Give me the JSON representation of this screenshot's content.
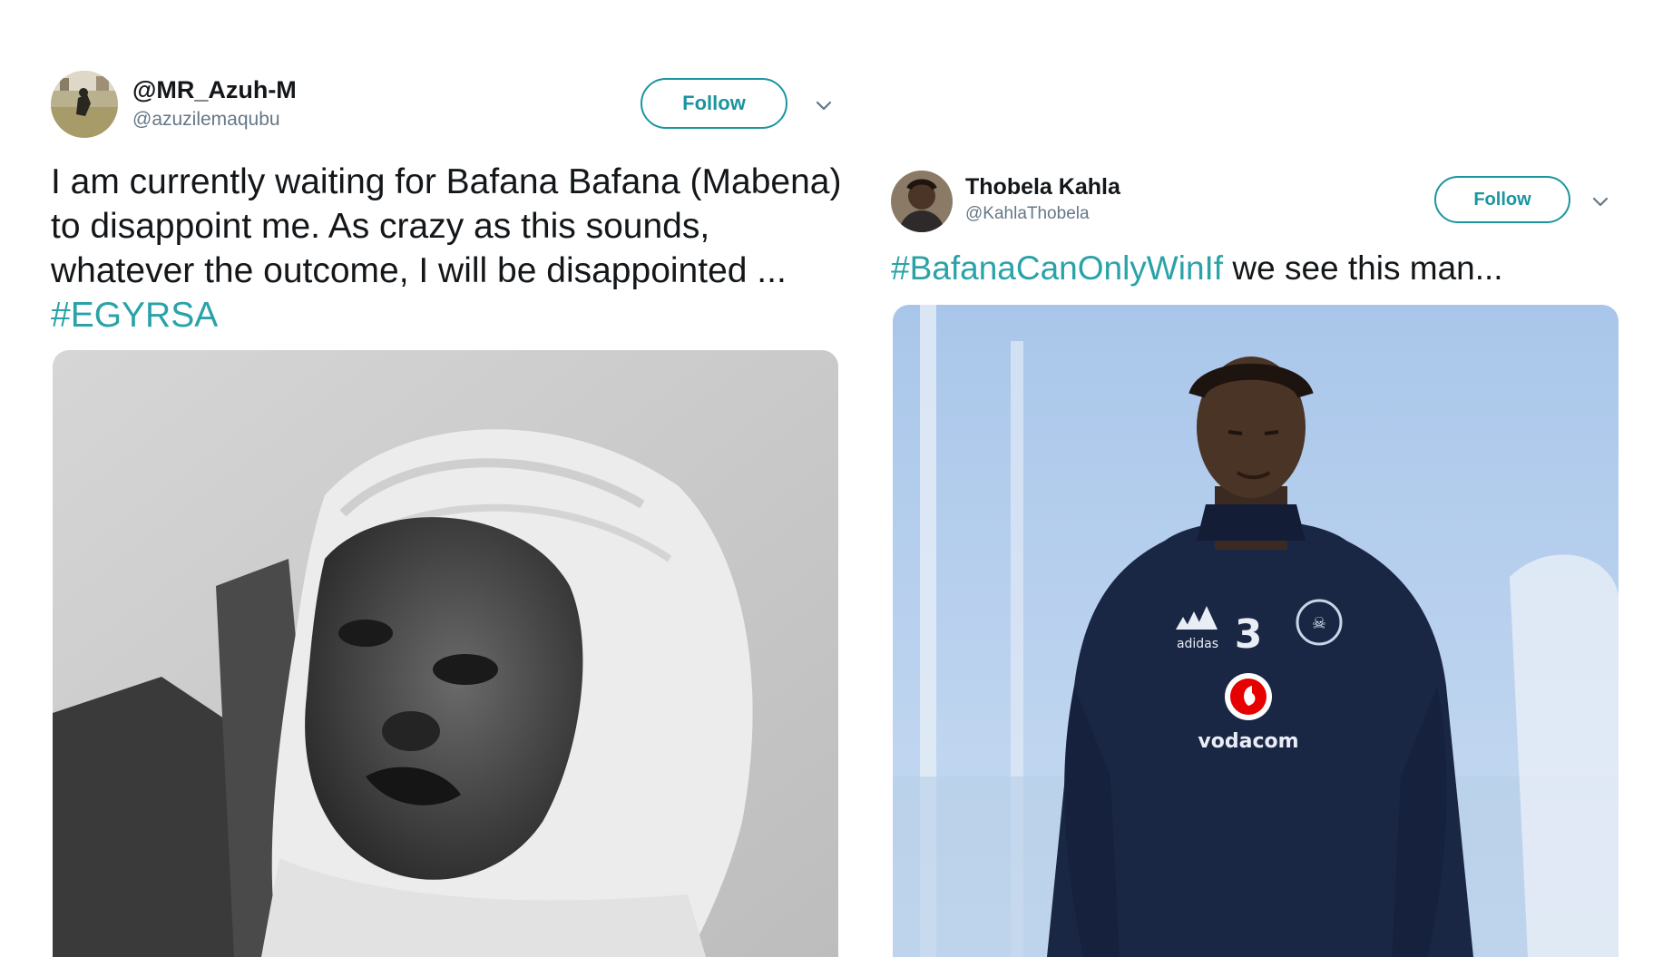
{
  "tweets": [
    {
      "display_name": "@MR_Azuh-M",
      "handle": "@azuzilemaqubu",
      "follow_label": "Follow",
      "text_plain": "I am currently waiting for Bafana Bafana (Mabena) to disappoint me. As crazy as this sounds, whatever the outcome, I will be disappointed ... ",
      "hashtag": "#EGYRSA",
      "media_kind": "photo-baby-in-knit-hood-bw"
    },
    {
      "display_name": "Thobela Kahla",
      "handle": "@KahlaThobela",
      "follow_label": "Follow",
      "hashtag": "#BafanaCanOnlyWinIf",
      "text_plain": " we see this man...",
      "media_kind": "photo-footballer-black-kit",
      "jersey": {
        "brand": "adidas",
        "number": "3",
        "sponsor": "vodacom"
      }
    }
  ],
  "colors": {
    "accent": "#1b95a0",
    "hashtag": "#2aa3a8",
    "handle": "#657786",
    "text": "#14171a"
  },
  "icons": {
    "more": "chevron-down-icon"
  }
}
